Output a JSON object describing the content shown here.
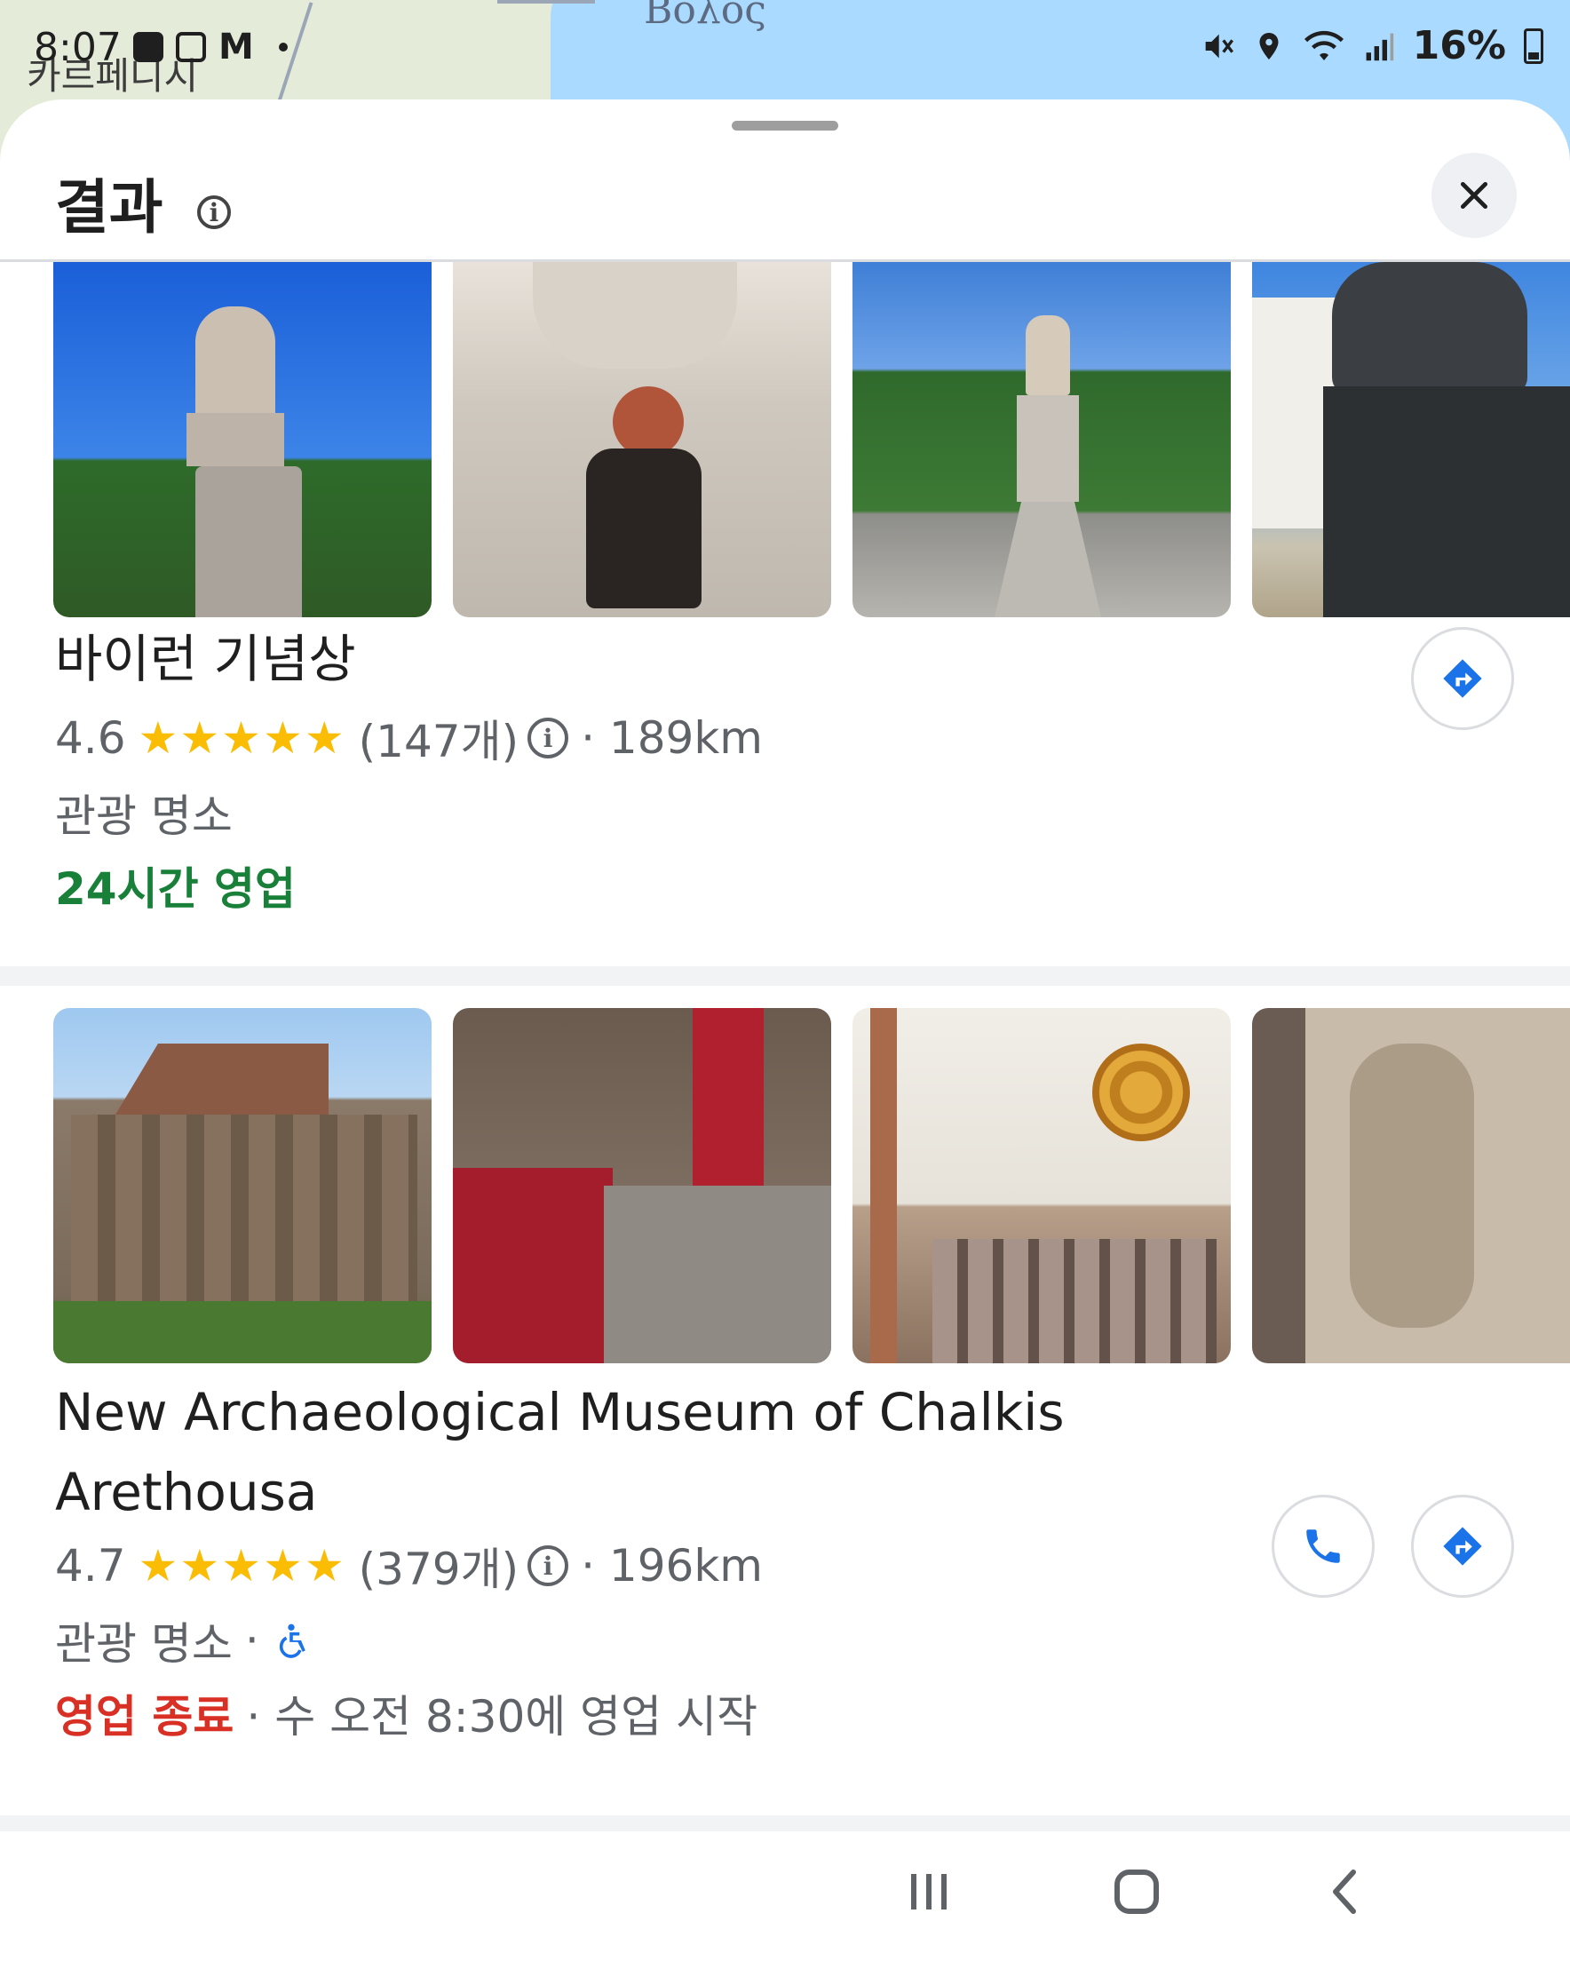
{
  "status_bar": {
    "time": "8:07",
    "battery": "16%"
  },
  "map": {
    "label_top": "Βόλος",
    "label_left": "카르페니시"
  },
  "sheet": {
    "title": "결과",
    "info_symbol": "i"
  },
  "results": [
    {
      "name": "바이런 기념상",
      "rating": "4.6",
      "stars": "★★★★★",
      "review_count": "(147개)",
      "distance": "· 189km",
      "category": "관광 명소",
      "hours": "24시간 영업",
      "hours_state": "open"
    },
    {
      "name_line1": "New Archaeological Museum of Chalkis",
      "name_line2": "Arethousa",
      "rating": "4.7",
      "stars": "★★★★★",
      "review_count": "(379개)",
      "distance": "· 196km",
      "category": "관광 명소",
      "separator": "·",
      "hours_status": "영업 종료",
      "hours_next": "· 수 오전 8:30에 영업 시작",
      "hours_state": "closed"
    }
  ],
  "icons": {
    "close": "close-icon",
    "directions": "directions-icon",
    "phone": "phone-icon",
    "wheelchair": "wheelchair-icon",
    "info": "info-icon"
  },
  "colors": {
    "star": "#fbbc04",
    "open": "#188038",
    "closed": "#d93025",
    "accent_blue": "#1a73e8"
  }
}
